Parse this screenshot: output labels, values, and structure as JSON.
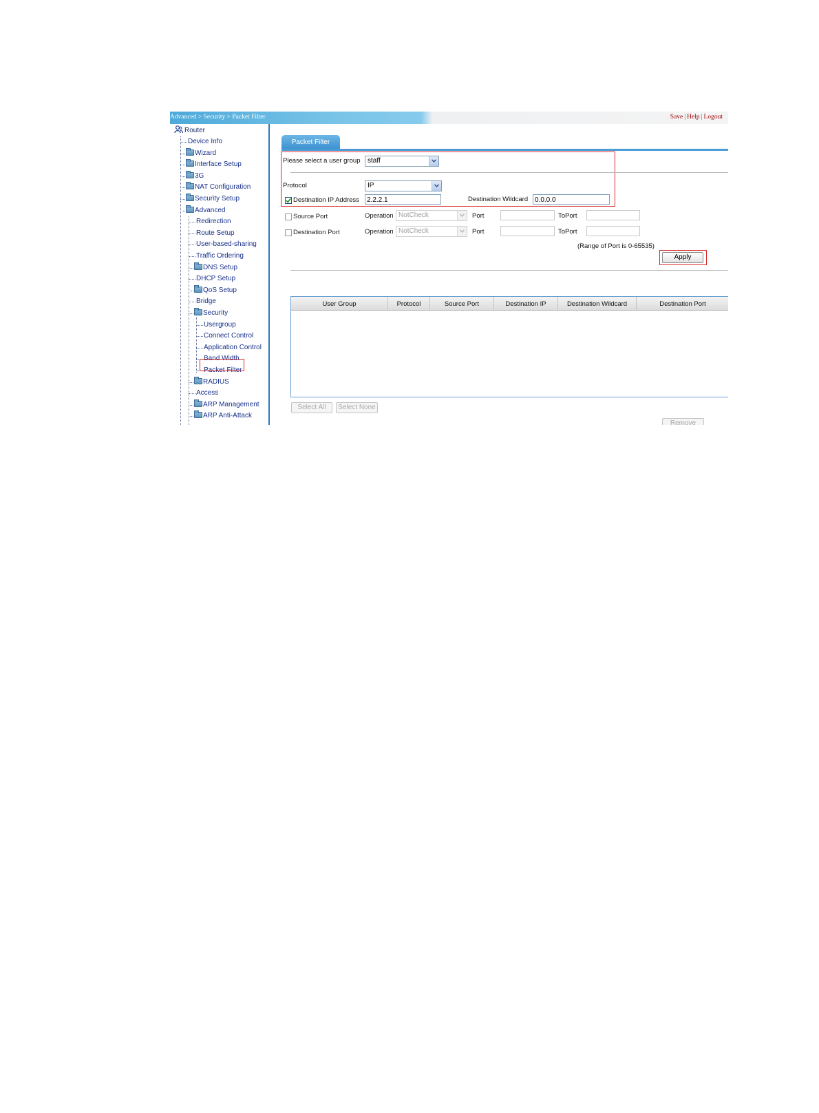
{
  "breadcrumb": "Advanced > Security > Packet Filter",
  "top_links": {
    "save": "Save",
    "help": "Help",
    "logout": "Logout",
    "separator": "|"
  },
  "sidebar": {
    "root": "Router",
    "items": [
      {
        "label": "Device Info",
        "folder": false
      },
      {
        "label": "Wizard",
        "folder": true
      },
      {
        "label": "Interface Setup",
        "folder": true
      },
      {
        "label": "3G",
        "folder": true
      },
      {
        "label": "NAT Configuration",
        "folder": true
      },
      {
        "label": "Security Setup",
        "folder": true
      },
      {
        "label": "Advanced",
        "folder": true
      },
      {
        "label": "Redirection",
        "folder": false
      },
      {
        "label": "Route Setup",
        "folder": false
      },
      {
        "label": "User-based-sharing",
        "folder": false
      },
      {
        "label": "Traffic Ordering",
        "folder": false
      },
      {
        "label": "DNS Setup",
        "folder": true
      },
      {
        "label": "DHCP Setup",
        "folder": false
      },
      {
        "label": "QoS Setup",
        "folder": true
      },
      {
        "label": "Bridge",
        "folder": false
      },
      {
        "label": "Security",
        "folder": true
      },
      {
        "label": "Usergroup",
        "folder": false
      },
      {
        "label": "Connect Control",
        "folder": false
      },
      {
        "label": "Application Control",
        "folder": false
      },
      {
        "label": "Band Width",
        "folder": false
      },
      {
        "label": "Packet Filter",
        "folder": false,
        "selected": true
      },
      {
        "label": "RADIUS",
        "folder": true
      },
      {
        "label": "Access",
        "folder": false
      },
      {
        "label": "ARP Management",
        "folder": true
      },
      {
        "label": "ARP Anti-Attack",
        "folder": true
      }
    ]
  },
  "main": {
    "tab": "Packet Filter",
    "user_group_label": "Please select a user group",
    "user_group_value": "staff",
    "protocol_label": "Protocol",
    "protocol_value": "IP",
    "dest_ip_label": "Destination IP Address",
    "dest_ip_checked": true,
    "dest_ip_value": "2.2.2.1",
    "dest_wildcard_label": "Destination Wildcard",
    "dest_wildcard_value": "0.0.0.0",
    "source_port_label": "Source Port",
    "source_port_checked": false,
    "dest_port_label": "Destination Port",
    "dest_port_checked": false,
    "operation_label": "Operation",
    "operation_value": "NotCheck",
    "port_label": "Port",
    "toport_label": "ToPort",
    "port_range_note": "(Range of Port is 0-65535)",
    "apply": "Apply",
    "table_headers": [
      "User Group",
      "Protocol",
      "Source Port",
      "Destination IP",
      "Destination Wildcard",
      "Destination Port"
    ],
    "select_all": "Select All",
    "select_none": "Select None",
    "remove": "Remove"
  },
  "colors": {
    "accent": "#3d93d2",
    "highlight": "#d62828",
    "link": "#990000"
  }
}
